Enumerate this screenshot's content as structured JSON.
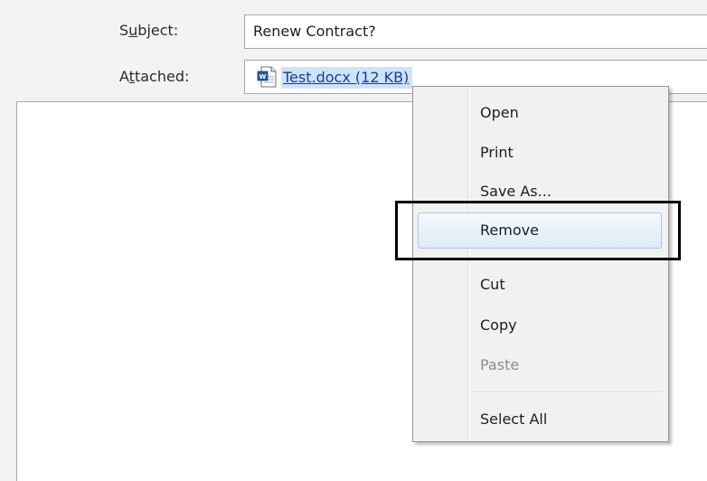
{
  "header": {
    "subject_label_pre": "S",
    "subject_label_accel": "u",
    "subject_label_post": "bject:",
    "subject_value": "Renew Contract?",
    "attached_label_pre": "A",
    "attached_label_accel": "t",
    "attached_label_post": "tached:",
    "attachment_name": "Test.docx (12 KB)"
  },
  "context_menu": {
    "items": [
      {
        "label": "Open"
      },
      {
        "label": "Print"
      },
      {
        "label": "Save As..."
      },
      {
        "label": "Remove"
      },
      {
        "label": "Cut"
      },
      {
        "label": "Copy"
      },
      {
        "label": "Paste"
      },
      {
        "label": "Select All"
      }
    ],
    "highlighted_item": "Remove"
  },
  "colors": {
    "selection": "#cde3f9",
    "link": "#1a3d94",
    "menu_bg": "#f1f1f1",
    "word_icon": "#2b579a",
    "annotation_box": "#000000"
  },
  "icons": {
    "attachment": "word-document-icon"
  }
}
